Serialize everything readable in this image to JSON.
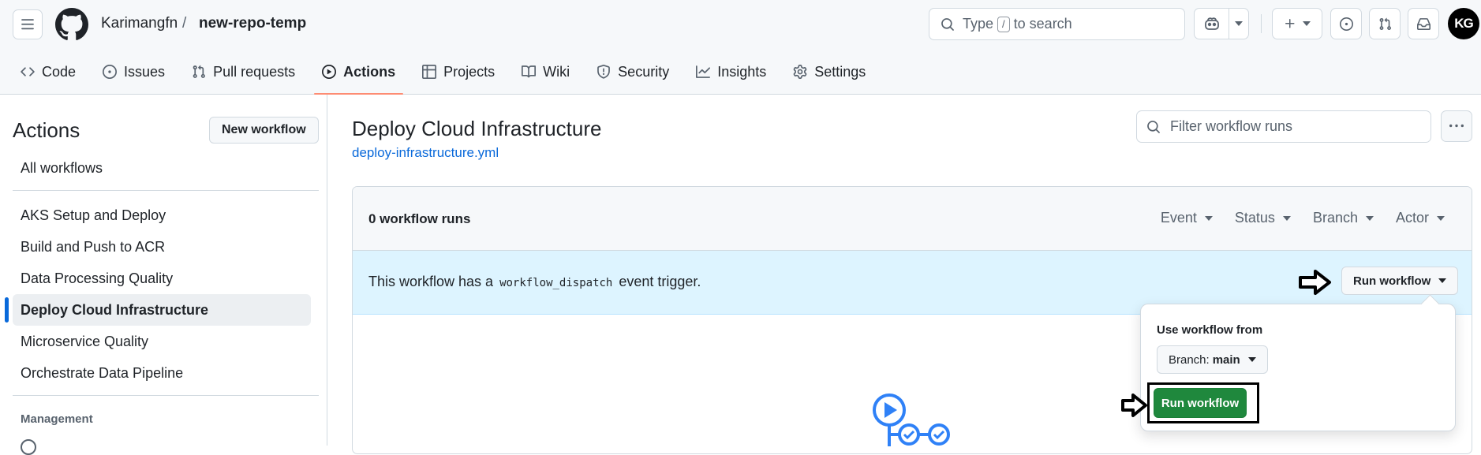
{
  "header": {
    "owner": "Karimangfn",
    "separator": "/",
    "repo": "new-repo-temp",
    "search_prefix": "Type",
    "search_key": "/",
    "search_suffix": "to search",
    "avatar_initials": "KG"
  },
  "tabs": [
    {
      "label": "Code",
      "icon": "code-icon"
    },
    {
      "label": "Issues",
      "icon": "issue-icon"
    },
    {
      "label": "Pull requests",
      "icon": "pull-request-icon"
    },
    {
      "label": "Actions",
      "icon": "play-icon",
      "active": true
    },
    {
      "label": "Projects",
      "icon": "table-icon"
    },
    {
      "label": "Wiki",
      "icon": "book-icon"
    },
    {
      "label": "Security",
      "icon": "shield-icon"
    },
    {
      "label": "Insights",
      "icon": "graph-icon"
    },
    {
      "label": "Settings",
      "icon": "gear-icon"
    }
  ],
  "sidebar": {
    "title": "Actions",
    "new_workflow": "New workflow",
    "all_workflows": "All workflows",
    "workflows": [
      "AKS Setup and Deploy",
      "Build and Push to ACR",
      "Data Processing Quality",
      "Deploy Cloud Infrastructure",
      "Microservice Quality",
      "Orchestrate Data Pipeline"
    ],
    "selected_index": 3,
    "management_label": "Management"
  },
  "main": {
    "title": "Deploy Cloud Infrastructure",
    "file": "deploy-infrastructure.yml",
    "filter_placeholder": "Filter workflow runs",
    "runs_count": "0 workflow runs",
    "filters": [
      "Event",
      "Status",
      "Branch",
      "Actor"
    ],
    "notice_prefix": "This workflow has a",
    "notice_code": "workflow_dispatch",
    "notice_suffix": "event trigger.",
    "run_workflow": "Run workflow"
  },
  "popover": {
    "label": "Use workflow from",
    "branch_prefix": "Branch:",
    "branch_value": "main",
    "run_button": "Run workflow"
  },
  "colors": {
    "accent_blue": "#0969da",
    "primary_green": "#1f883d",
    "notice_bg": "#ddf4ff",
    "tab_underline": "#fd8c73"
  }
}
